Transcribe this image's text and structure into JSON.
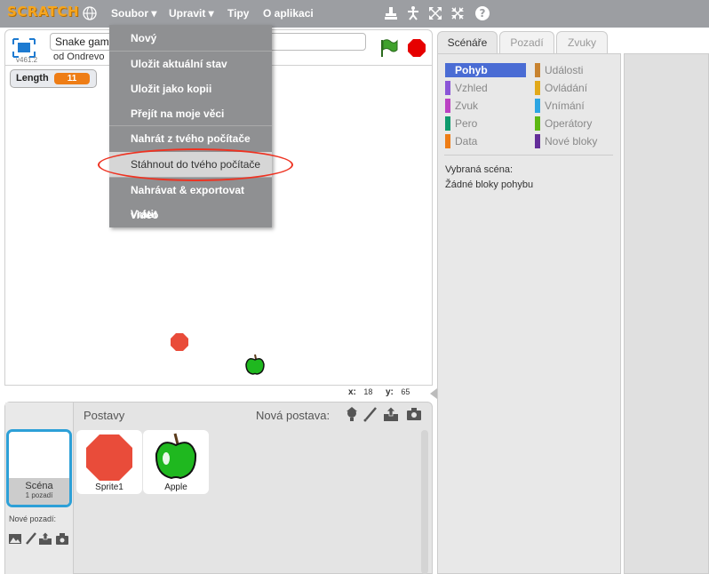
{
  "topbar": {
    "logo": "SCRATCH",
    "menu": {
      "file": "Soubor ▾",
      "edit": "Upravit ▾",
      "tips": "Tipy",
      "about": "O aplikaci"
    }
  },
  "stage": {
    "project_title": "Snake gam",
    "byline": "od Ondrevo",
    "version": "v461.2",
    "monitor": {
      "label": "Length",
      "value": "11"
    },
    "coords": {
      "x_label": "x:",
      "x_value": "18",
      "y_label": "y:",
      "y_value": "65"
    }
  },
  "file_menu": {
    "items": [
      "Nový",
      "Uložit aktuální stav",
      "Uložit jako kopii",
      "Přejít na moje věci",
      "Nahrát z tvého počítače",
      "Stáhnout do tvého počítače",
      "Nahrávat  & exportovat video",
      "Vrátit"
    ]
  },
  "sprites_panel": {
    "title": "Postavy",
    "new_sprite": "Nová postava:",
    "scene": {
      "name": "Scéna",
      "sub": "1 pozadí"
    },
    "new_backdrop": "Nové pozadí:",
    "sprites": [
      {
        "name": "Sprite1"
      },
      {
        "name": "Apple"
      }
    ]
  },
  "tabs": {
    "scripts": "Scénáře",
    "backdrops": "Pozadí",
    "sounds": "Zvuky"
  },
  "palette": {
    "categories": [
      {
        "label": "Pohyb",
        "color": "#4a6cd4"
      },
      {
        "label": "Vzhled",
        "color": "#8a55d7"
      },
      {
        "label": "Zvuk",
        "color": "#bb42c3"
      },
      {
        "label": "Pero",
        "color": "#0e9a6c"
      },
      {
        "label": "Data",
        "color": "#ee7d16"
      },
      {
        "label": "Události",
        "color": "#c88330"
      },
      {
        "label": "Ovládání",
        "color": "#e1a91a"
      },
      {
        "label": "Vnímání",
        "color": "#2ca5e2"
      },
      {
        "label": "Operátory",
        "color": "#5cb712"
      },
      {
        "label": "Nové bloky",
        "color": "#632d99"
      }
    ],
    "selected_scene_label": "Vybraná scéna:",
    "no_blocks_text": "Žádné bloky pohybu"
  }
}
